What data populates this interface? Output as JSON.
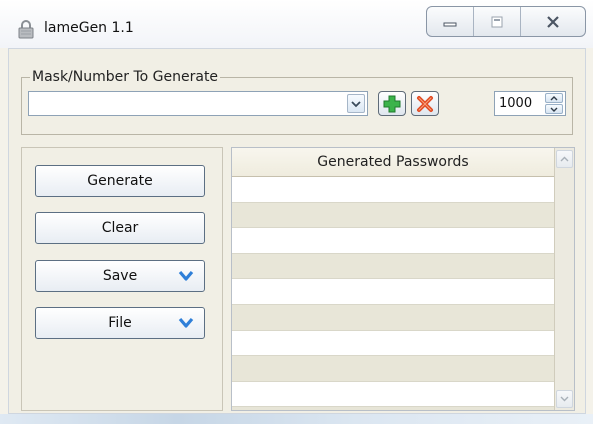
{
  "window": {
    "title": "lameGen 1.1",
    "caption_buttons": [
      "minimize",
      "maximize",
      "close"
    ]
  },
  "mask_group": {
    "legend": "Mask/Number To Generate",
    "combo_value": "",
    "add_icon": "add-icon",
    "remove_icon": "remove-icon",
    "count_value": "1000"
  },
  "actions": {
    "generate_label": "Generate",
    "clear_label": "Clear",
    "save_label": "Save",
    "file_label": "File"
  },
  "grid": {
    "header": "Generated Passwords",
    "rows": [
      "",
      "",
      "",
      "",
      "",
      "",
      "",
      "",
      ""
    ]
  },
  "colors": {
    "accent_blue": "#2f7fd8",
    "add_green": "#3bb34a",
    "remove_red": "#e24a22",
    "header_bg": "#f2efe3"
  }
}
